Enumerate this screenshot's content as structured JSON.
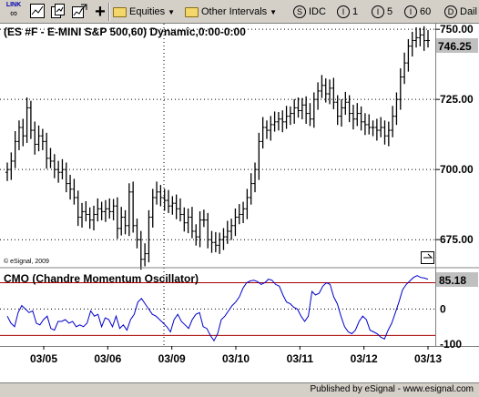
{
  "toolbar": {
    "link_label": "LINK",
    "equities": "Equities",
    "other_intervals": "Other Intervals",
    "idc": "IDC",
    "interval_1": "1",
    "interval_5": "5",
    "interval_60": "60",
    "daily": "Dail"
  },
  "price_pane": {
    "title": "(ES #F - E-MINI S&P 500,60) Dynamic,0:00-0:00",
    "last_price": "746.25",
    "watermark": "© eSignal, 2009",
    "y_ticks": [
      "750.00",
      "725.00",
      "700.00",
      "675.00"
    ]
  },
  "cmo_pane": {
    "title": "CMO (Chandre Momentum Oscillator)",
    "last_value": "85.18",
    "y_ticks": [
      "0",
      "-100"
    ]
  },
  "x_ticks": [
    "03/05",
    "03/06",
    "03/09",
    "03/10",
    "03/11",
    "03/12",
    "03/13"
  ],
  "footer": {
    "text": "Published by eSignal - www.esignal.com"
  },
  "colors": {
    "price_bars": "#000000",
    "cmo_line": "#0000cc",
    "band_lines": "#aa0000",
    "last_box": "#c0c0c0"
  },
  "chart_data": [
    {
      "type": "line",
      "title": "(ES #F - E-MINI S&P 500,60) Dynamic,0:00-0:00",
      "ylim": [
        665,
        752
      ],
      "x": [
        "03/05",
        "03/06",
        "03/09",
        "03/10",
        "03/11",
        "03/12",
        "03/13"
      ],
      "series": [
        {
          "values": [
            700,
            703,
            710,
            715,
            712,
            722,
            714,
            709,
            712,
            710,
            704,
            703,
            700,
            699,
            700,
            695,
            693,
            690,
            683,
            685,
            684,
            682,
            684,
            686,
            685,
            686,
            685,
            687,
            679,
            683,
            680,
            692,
            680,
            675,
            668,
            670,
            683,
            690,
            692,
            690,
            689,
            687,
            688,
            686,
            684,
            681,
            683,
            678,
            676,
            682,
            682,
            675,
            674,
            673,
            675,
            676,
            678,
            680,
            683,
            684,
            686,
            690,
            695,
            700,
            710,
            715,
            714,
            716,
            717,
            718,
            717,
            719,
            720,
            722,
            721,
            723,
            720,
            718,
            725,
            728,
            730,
            727,
            729,
            724,
            719,
            722,
            724,
            720,
            718,
            720,
            717,
            716,
            715,
            715,
            714,
            715,
            712,
            714,
            719,
            725,
            733,
            738,
            744,
            746,
            747,
            748,
            746,
            746
          ]
        }
      ]
    },
    {
      "type": "line",
      "title": "CMO (Chandre Momentum Oscillator)",
      "ylim": [
        -105,
        115
      ],
      "reference_lines": [
        75,
        -75
      ],
      "series": [
        {
          "values": [
            -20,
            -40,
            -50,
            -10,
            10,
            0,
            -10,
            -5,
            -40,
            -45,
            -30,
            -20,
            -55,
            -60,
            -35,
            -35,
            -30,
            -40,
            -35,
            -50,
            -45,
            -50,
            -40,
            -5,
            -20,
            -15,
            -50,
            -25,
            -30,
            -50,
            -20,
            -55,
            -45,
            -60,
            -30,
            -15,
            20,
            30,
            15,
            0,
            -15,
            -20,
            -30,
            -40,
            -50,
            -65,
            -30,
            -15,
            -35,
            -45,
            -55,
            -30,
            -15,
            -10,
            -50,
            -55,
            -75,
            -90,
            -70,
            -30,
            -20,
            -5,
            10,
            20,
            35,
            60,
            75,
            80,
            82,
            78,
            70,
            75,
            85,
            82,
            70,
            65,
            40,
            20,
            15,
            5,
            0,
            -20,
            -35,
            -20,
            50,
            40,
            45,
            65,
            75,
            70,
            35,
            15,
            -20,
            -50,
            -65,
            -70,
            -60,
            -35,
            -20,
            -30,
            -60,
            -65,
            -70,
            -80,
            -85,
            -60,
            -40,
            -10,
            20,
            55,
            70,
            80,
            90,
            95,
            90,
            88,
            85
          ]
        }
      ]
    }
  ]
}
